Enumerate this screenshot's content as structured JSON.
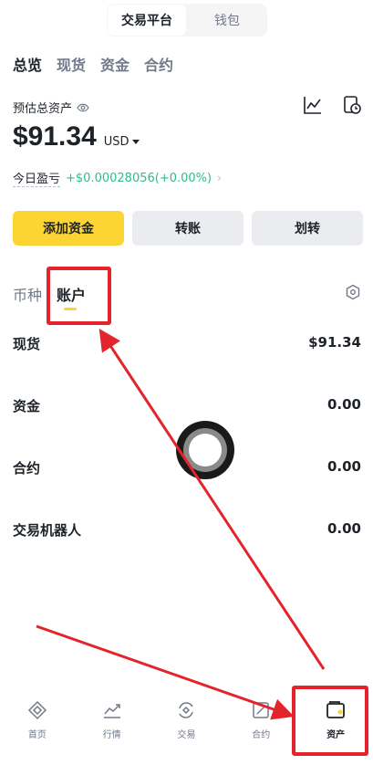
{
  "top_switch": {
    "items": [
      "交易平台",
      "钱包"
    ],
    "active": 0
  },
  "tabs": [
    "总览",
    "现货",
    "资金",
    "合约"
  ],
  "estimate": {
    "label": "预估总资产",
    "balance": "$91.34",
    "currency": "USD",
    "pnl_label": "今日盈亏",
    "pnl_value": "+$0.00028056(+0.00%)"
  },
  "buttons": {
    "add_funds": "添加资金",
    "transfer_account": "转账",
    "transfer": "划转"
  },
  "sub_tabs": [
    "币种",
    "账户"
  ],
  "accounts": [
    {
      "name": "现货",
      "value": "$91.34"
    },
    {
      "name": "资金",
      "value": "0.00"
    },
    {
      "name": "合约",
      "value": "0.00"
    },
    {
      "name": "交易机器人",
      "value": "0.00"
    }
  ],
  "bottom_nav": [
    {
      "label": "首页",
      "icon": "home-icon"
    },
    {
      "label": "行情",
      "icon": "markets-icon"
    },
    {
      "label": "交易",
      "icon": "trade-icon"
    },
    {
      "label": "合约",
      "icon": "futures-icon"
    },
    {
      "label": "资产",
      "icon": "wallet-icon"
    }
  ],
  "colors": {
    "accent": "#fcd535",
    "positive": "#2ebd85",
    "annotation": "#e3242b"
  }
}
